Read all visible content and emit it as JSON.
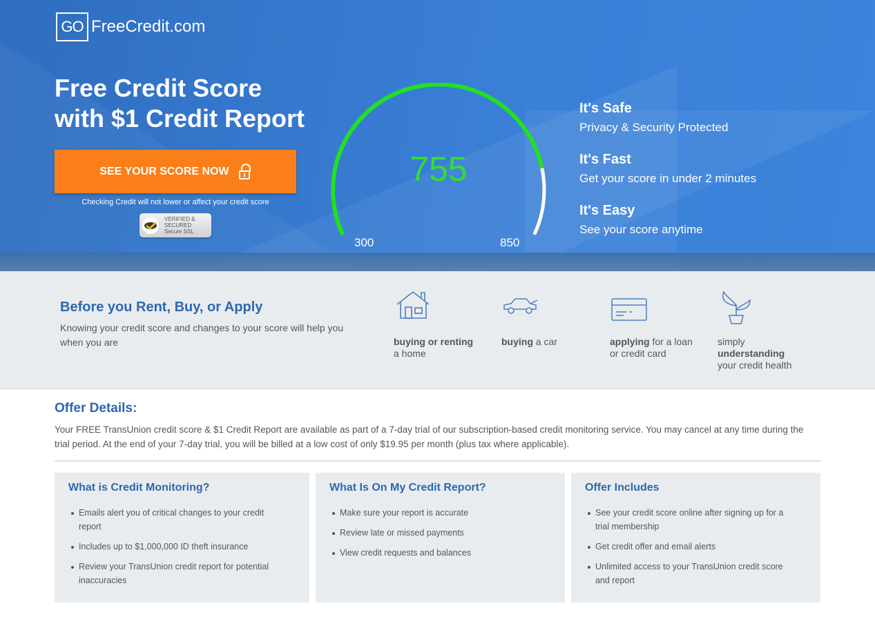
{
  "brand": {
    "logo_box": "GO",
    "logo_text": "FreeCredit.com"
  },
  "hero": {
    "headline_line1": "Free Credit Score",
    "headline_line2": "with $1 Credit Report",
    "cta_label": "SEE YOUR SCORE NOW",
    "cta_icon": "lock-icon",
    "disclaimer": "Checking Credit will not lower or affect your credit score",
    "ssl_badge": {
      "line1": "VERIFIED &",
      "line2": "SECURED",
      "line3": "Secure SSL"
    },
    "gauge": {
      "score": "755",
      "min": "300",
      "max": "850",
      "fill_fraction": 0.84,
      "fill_color": "#22e022",
      "track_color": "#ffffff"
    },
    "features": [
      {
        "title": "It's Safe",
        "desc": "Privacy & Security Protected"
      },
      {
        "title": "It's Fast",
        "desc": "Get your score in under 2 minutes"
      },
      {
        "title": "It's Easy",
        "desc": "See your score anytime"
      }
    ]
  },
  "before": {
    "title": "Before you Rent, Buy, or Apply",
    "text": "Knowing your credit score and changes to your score will help you when you are",
    "uses": [
      {
        "icon": "house-icon",
        "bold": "buying or renting",
        "rest": "a home"
      },
      {
        "icon": "car-icon",
        "bold": "buying",
        "rest": "a car"
      },
      {
        "icon": "credit-card-icon",
        "bold": "applying",
        "rest": "for a loan or credit card"
      },
      {
        "icon": "plant-icon",
        "pre": "simply",
        "bold": "understanding",
        "rest": "your credit health"
      }
    ]
  },
  "offer": {
    "title": "Offer Details:",
    "text": "Your FREE TransUnion credit score & $1 Credit Report are available as part of a 7-day trial of our subscription-based credit monitoring service. You may cancel at any time during the trial period. At the end of your 7-day trial, you will be billed at a low cost of only $19.95 per month (plus tax where applicable)."
  },
  "cards": [
    {
      "title": "What is Credit Monitoring?",
      "items": [
        "Emails alert you of critical changes to your credit report",
        "Includes up to $1,000,000 ID theft insurance",
        "Review your TransUnion credit report for potential inaccuracies"
      ]
    },
    {
      "title": "What Is On My Credit Report?",
      "items": [
        "Make sure your report is accurate",
        "Review late or missed payments",
        "View credit requests and balances"
      ]
    },
    {
      "title": "Offer Includes",
      "items": [
        "See your credit score online after signing up for a trial membership",
        "Get credit offer and email alerts",
        "Unlimited access to your TransUnion credit score and report"
      ]
    }
  ],
  "colors": {
    "accent": "#2d68b1",
    "cta": "#fa7f1a",
    "score": "#33dd33",
    "hero": "#3a7fd6"
  }
}
